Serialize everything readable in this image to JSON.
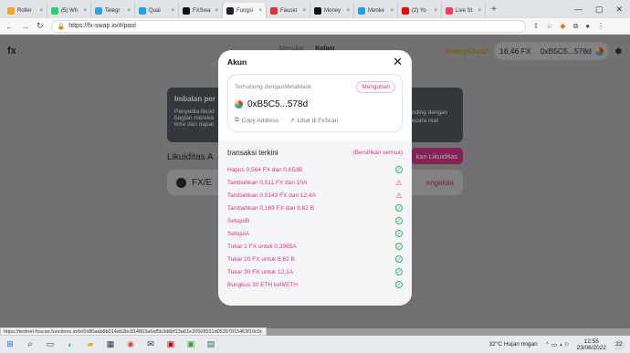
{
  "browser": {
    "tabs": [
      {
        "label": "Roller",
        "color": "#f5a623"
      },
      {
        "label": "(5) Wh",
        "color": "#25d366"
      },
      {
        "label": "Telegr",
        "color": "#2aa3de"
      },
      {
        "label": "Quai",
        "color": "#1da1f2"
      },
      {
        "label": "FXSwa",
        "color": "#111111"
      },
      {
        "label": "Fungsi",
        "color": "#222222",
        "active": true
      },
      {
        "label": "Faucet",
        "color": "#e03030"
      },
      {
        "label": "Money",
        "color": "#111111"
      },
      {
        "label": "Monke",
        "color": "#1da1f2"
      },
      {
        "label": "(2) Yo",
        "color": "#ff0000"
      },
      {
        "label": "Live St",
        "color": "#ff3b5c"
      }
    ],
    "url": "https://fx-swap.io/#/pool"
  },
  "app": {
    "logo": "fx",
    "nav": [
      "Menukar",
      "Kolam"
    ],
    "username": "DhobyGhaut",
    "balance": "18,46 FX",
    "wallet_short": "0xB5C5...578d",
    "bg_card_title": "Imbalan per",
    "bg_card_text1": "Penyedia likuid",
    "bg_card_text2": "bagian mereka",
    "bg_card_text3": "time dan dapat",
    "bg_card_right1": "nding dengan",
    "bg_card_right2": "ecara real",
    "liquidity_label": "Likuiditas A",
    "add_liquidity": "kan Likuiditas",
    "pair": "FX/E",
    "manage": "engelola"
  },
  "modal": {
    "title": "Akun",
    "connected": "Terhubung denganMetaMask",
    "change": "Mengubah",
    "address": "0xB5C5...578d",
    "copy": "Copy Address",
    "view": "Lihat di FxScan",
    "tx_title": "transaksi terkini",
    "clear_all": "(Bersihkan semua)",
    "transactions": [
      {
        "text": "Hapus 0,564 FX dan 0,653B",
        "status": "ok"
      },
      {
        "text": "Tambahkan 0,511 FX dan 10A",
        "status": "fail"
      },
      {
        "text": "Tambahkan 0,0143 FX dan 12,4A",
        "status": "fail"
      },
      {
        "text": "Tambahkan 0,169 FX dan 8,62 B",
        "status": "ok"
      },
      {
        "text": "SetujuiB",
        "status": "ok"
      },
      {
        "text": "SetujuiA",
        "status": "ok"
      },
      {
        "text": "Tukar 1 FX untuk 0,3965A",
        "status": "ok"
      },
      {
        "text": "Tukar 20 FX untuk 8,62 B",
        "status": "ok"
      },
      {
        "text": "Tukar 30 FX untuk 12,1A",
        "status": "ok"
      },
      {
        "text": "Bungkus 30 ETH keWETH",
        "status": "ok"
      }
    ]
  },
  "status_url": "https://testnet-fxscan.functionx.io/tx/0x80aab8b014eb2bc814803a6af5b3d6bf13a61e20508551d05397915463f10c0c",
  "taskbar": {
    "weather": "32°C  Hujan ringan",
    "time": "12:55",
    "date": "23/06/2022",
    "notif": "22"
  },
  "colors": {
    "accent": "#e0337a",
    "success": "#33b36b",
    "error": "#e34848"
  }
}
